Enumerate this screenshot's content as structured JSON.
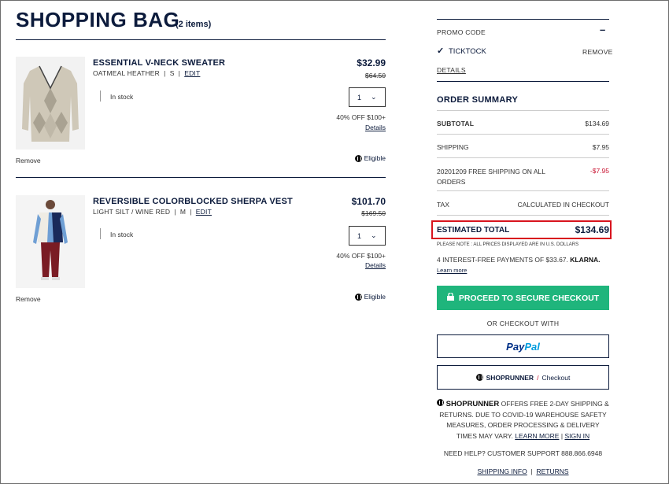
{
  "header": {
    "title": "SHOPPING BAG",
    "count": "(2 items)"
  },
  "items": [
    {
      "name": "ESSENTIAL V-NECK SWEATER",
      "color": "OATMEAL HEATHER",
      "size": "S",
      "edit": "EDIT",
      "price": "$32.99",
      "original_price": "$64.50",
      "stock": "In stock",
      "qty": "1",
      "promo": "40% OFF $100+",
      "details": "Details",
      "remove": "Remove",
      "eligible": "Eligible"
    },
    {
      "name": "REVERSIBLE COLORBLOCKED SHERPA VEST",
      "color": "LIGHT SILT / WINE RED",
      "size": "M",
      "edit": "EDIT",
      "price": "$101.70",
      "original_price": "$169.50",
      "stock": "In stock",
      "qty": "1",
      "promo": "40% OFF $100+",
      "details": "Details",
      "remove": "Remove",
      "eligible": "Eligible"
    }
  ],
  "promo": {
    "label": "PROMO CODE",
    "toggle": "–",
    "code": "TICKTOCK",
    "remove": "REMOVE",
    "details": "DETAILS"
  },
  "summary": {
    "title": "ORDER SUMMARY",
    "subtotal_label": "SUBTOTAL",
    "subtotal": "$134.69",
    "shipping_label": "SHIPPING",
    "shipping": "$7.95",
    "discount_label": "20201209 FREE SHIPPING ON ALL ORDERS",
    "discount": "-$7.95",
    "tax_label": "TAX",
    "tax": "CALCULATED IN CHECKOUT",
    "total_label": "ESTIMATED TOTAL",
    "total": "$134.69",
    "note": "PLEASE NOTE : ALL PRICES DISPLAYED ARE IN U.S. DOLLARS",
    "klarna_text": "4 INTEREST-FREE PAYMENTS OF $33.67.",
    "klarna_brand": "KLARNA.",
    "learn_more": "Learn more"
  },
  "checkout": {
    "proceed": "PROCEED TO SECURE CHECKOUT",
    "or": "OR CHECKOUT WITH",
    "paypal_pay": "Pay",
    "paypal_pal": "Pal",
    "shoprunner": "SHOPRUNNER",
    "shoprunner_sep": "/",
    "shoprunner_checkout": "Checkout"
  },
  "shoprunner_info": {
    "brand": "SHOPRUNNER",
    "text": "OFFERS FREE 2-DAY SHIPPING & RETURNS. DUE TO COVID-19 WAREHOUSE SAFETY MEASURES, ORDER PROCESSING & DELIVERY TIMES MAY VARY.",
    "learn": "LEARN MORE",
    "sep": "|",
    "signin": "SIGN IN"
  },
  "support": {
    "text": "NEED HELP? CUSTOMER SUPPORT 888.866.6948"
  },
  "footer_links": {
    "shipping": "SHIPPING INFO",
    "sep": "|",
    "returns": "RETURNS"
  },
  "colors": {
    "navy": "#0c1b3c",
    "green": "#1fb57c",
    "red": "#c8102e",
    "highlight": "#d8141e",
    "paypal_dark": "#003087",
    "paypal_light": "#009cde"
  }
}
